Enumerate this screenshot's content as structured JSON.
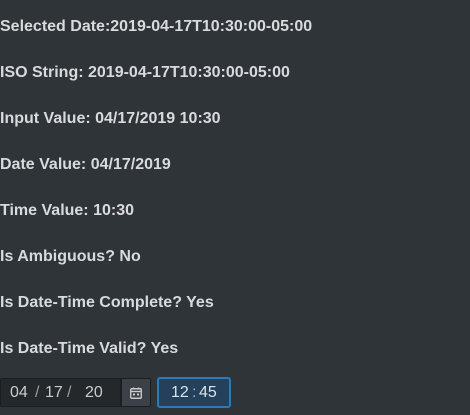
{
  "info": {
    "selected_date": "Selected Date:2019-04-17T10:30:00-05:00",
    "iso_string": "ISO String: 2019-04-17T10:30:00-05:00",
    "input_value": "Input Value: 04/17/2019 10:30",
    "date_value": "Date Value: 04/17/2019",
    "time_value": "Time Value: 10:30",
    "is_ambiguous": "Is Ambiguous? No",
    "is_complete": "Is Date-Time Complete? Yes",
    "is_valid": "Is Date-Time Valid? Yes"
  },
  "date_input": {
    "month": "04",
    "day": "17",
    "year": "20",
    "separator": "/"
  },
  "calendar_button": {
    "icon": "calendar-icon"
  },
  "time_input": {
    "hour": "12",
    "minute": "45",
    "separator": ":"
  },
  "colors": {
    "background": "#2f3438",
    "text": "#d8dadb",
    "focus_border": "#2a7bb8",
    "focus_fill": "#24405a"
  }
}
